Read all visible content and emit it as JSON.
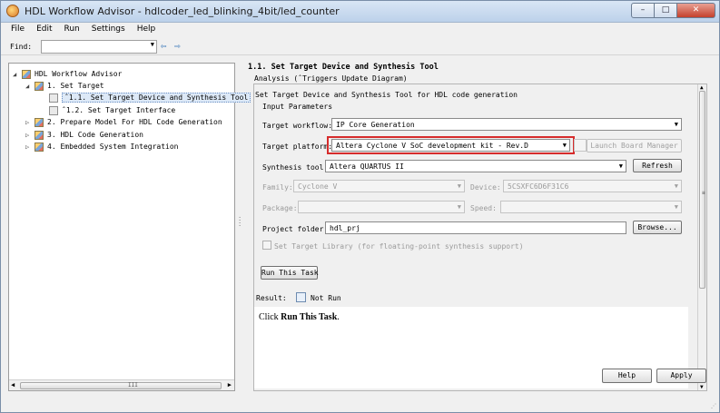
{
  "window": {
    "title": "HDL Workflow Advisor - hdlcoder_led_blinking_4bit/led_counter"
  },
  "menu": [
    "File",
    "Edit",
    "Run",
    "Settings",
    "Help"
  ],
  "find": {
    "label": "Find:",
    "value": ""
  },
  "tree": {
    "root": "HDL Workflow Advisor",
    "set_target": "1. Set Target",
    "task_1_1": "ˆ1.1. Set Target Device and Synthesis Tool",
    "task_1_2": "ˆ1.2. Set Target Interface",
    "prepare": "2. Prepare Model For HDL Code Generation",
    "codegen": "3. HDL Code Generation",
    "embedded": "4. Embedded System Integration",
    "scroll_grip": "III"
  },
  "task": {
    "title": "1.1. Set Target Device and Synthesis Tool",
    "analysis": "Analysis (ˆTriggers Update Diagram)",
    "description": "Set Target Device and Synthesis Tool for HDL code generation",
    "section": "Input Parameters"
  },
  "params": {
    "workflow_label": "Target workflow:",
    "workflow_value": "IP Core Generation",
    "platform_label": "Target platform:",
    "platform_value": "Altera Cyclone V SoC development kit - Rev.D",
    "launch_label": "Launch Board Manager",
    "synth_label": "Synthesis tool:",
    "synth_value": "Altera QUARTUS II",
    "refresh_label": "Refresh",
    "family_label": "Family:",
    "family_value": "Cyclone V",
    "device_label": "Device:",
    "device_value": "5CSXFC6D6F31C6",
    "package_label": "Package:",
    "package_value": "",
    "speed_label": "Speed:",
    "speed_value": "",
    "folder_label": "Project folder:",
    "folder_value": "hdl_prj",
    "browse_label": "Browse...",
    "target_lib_label": "Set Target Library (for floating-point synthesis support)"
  },
  "run": {
    "button": "Run This Task",
    "result_label": "Result:",
    "result_value": "Not Run",
    "msg_prefix": "Click ",
    "msg_bold": "Run This Task",
    "msg_suffix": "."
  },
  "footer": {
    "help": "Help",
    "apply": "Apply"
  }
}
